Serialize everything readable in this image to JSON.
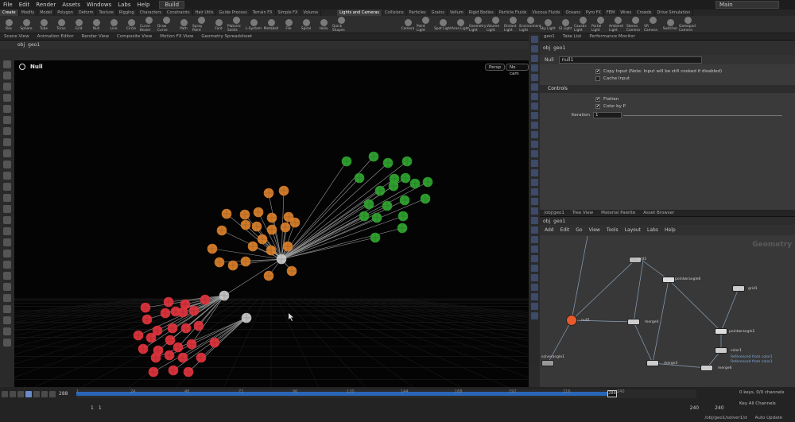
{
  "menubar": {
    "items": [
      "File",
      "Edit",
      "Render",
      "Assets",
      "Windows",
      "Labs",
      "Help"
    ],
    "desktop": "Build",
    "right_desktop": "Main"
  },
  "shelf": {
    "tabs_left": [
      "Create",
      "Modify",
      "Model",
      "Polygon",
      "Deform",
      "Texture",
      "Rigging",
      "Characters",
      "Constraints",
      "Hair Utils",
      "Guide Process",
      "Terrain FX",
      "Simple FX",
      "Volume"
    ],
    "tools_left": [
      "Box",
      "Sphere",
      "Tube",
      "Torus",
      "Grid",
      "Null",
      "Line",
      "Circle",
      "Curve Bezier",
      "Draw Curve",
      "Path",
      "Spray Paint",
      "Font",
      "Platonic Solids",
      "L-System",
      "Metaball",
      "File",
      "Spiral",
      "Helix",
      "Quick Shapes"
    ],
    "tabs_right": [
      "Lights and Cameras",
      "Collisions",
      "Particles",
      "Grains",
      "Vellum",
      "Rigid Bodies",
      "Particle Fluids",
      "Viscous Fluids",
      "Oceans",
      "Pyro FX",
      "FEM",
      "Wires",
      "Crowds",
      "Drive Simulation"
    ],
    "tools_right": [
      "Camera",
      "Point Light",
      "Spot Light",
      "Area Light",
      "Geometry Light",
      "Volume Light",
      "Distant Light",
      "Environment Light",
      "Sky Light",
      "GI Light",
      "Caustic Light",
      "Portal Light",
      "Ambient Light",
      "Stereo Camera",
      "VR Camera",
      "Switcher",
      "Gamepad Camera"
    ]
  },
  "left": {
    "tabs": [
      "Scene View",
      "Animation Editor",
      "Render View",
      "Composite View",
      "Motion FX View",
      "Geometry Spreadsheet"
    ],
    "path": "obj",
    "node": "geo1",
    "viewport_title": "Null",
    "persp": "Persp",
    "cam": "No cam"
  },
  "param": {
    "tabs": [
      "geo1",
      "Take List",
      "Performance Monitor"
    ],
    "path": "obj",
    "node": "geo1",
    "node_type": "Null",
    "node_name": "null1",
    "copy_input": "Copy Input (Note: Input will be still cooked if disabled)",
    "cache_input": "Cache Input",
    "section": "Controls",
    "flatten": "Flatten",
    "color_by_p": "Color by P",
    "iteration_label": "Iteration",
    "iteration_value": "1"
  },
  "net": {
    "tabs": [
      "/obj/geo1",
      "Tree View",
      "Material Palette",
      "Asset Browser"
    ],
    "path": "obj",
    "node": "geo1",
    "menu": [
      "Add",
      "Edit",
      "Go",
      "View",
      "Tools",
      "Layout",
      "Labs",
      "Help"
    ],
    "watermark": "Geometry",
    "nodes": {
      "split1": "split1",
      "pointwrangle": "pointwrangle6",
      "grid": "grid1",
      "null": "null1",
      "merge4": "merge4",
      "pwrangle2": "pointwrangle1",
      "color": "color1",
      "merge3": "merge3",
      "merge6": "merge6",
      "solver": "solverangle1",
      "ref1": "Referenced from color1",
      "ref2": "Referenced from color1"
    }
  },
  "timeline": {
    "frame": "288",
    "ticks": [
      "1",
      "24",
      "48",
      "72",
      "96",
      "120",
      "144",
      "168",
      "192",
      "216",
      "240"
    ],
    "playhead": "288",
    "range_start": "1",
    "range_start2": "1",
    "range_end": "240",
    "range_end2": "240",
    "keys": "0 keys, 0/0 channels",
    "key_all": "Key All Channels",
    "status_path": "/obj/geo1/solver1/d",
    "auto_update": "Auto Update"
  },
  "colors": {
    "red": "#e0343d",
    "orange": "#d9802b",
    "green": "#2fa32f",
    "white": "#c8c8c8",
    "timeline_fill": "#2a66b8",
    "null_node": "#e85a2c"
  }
}
